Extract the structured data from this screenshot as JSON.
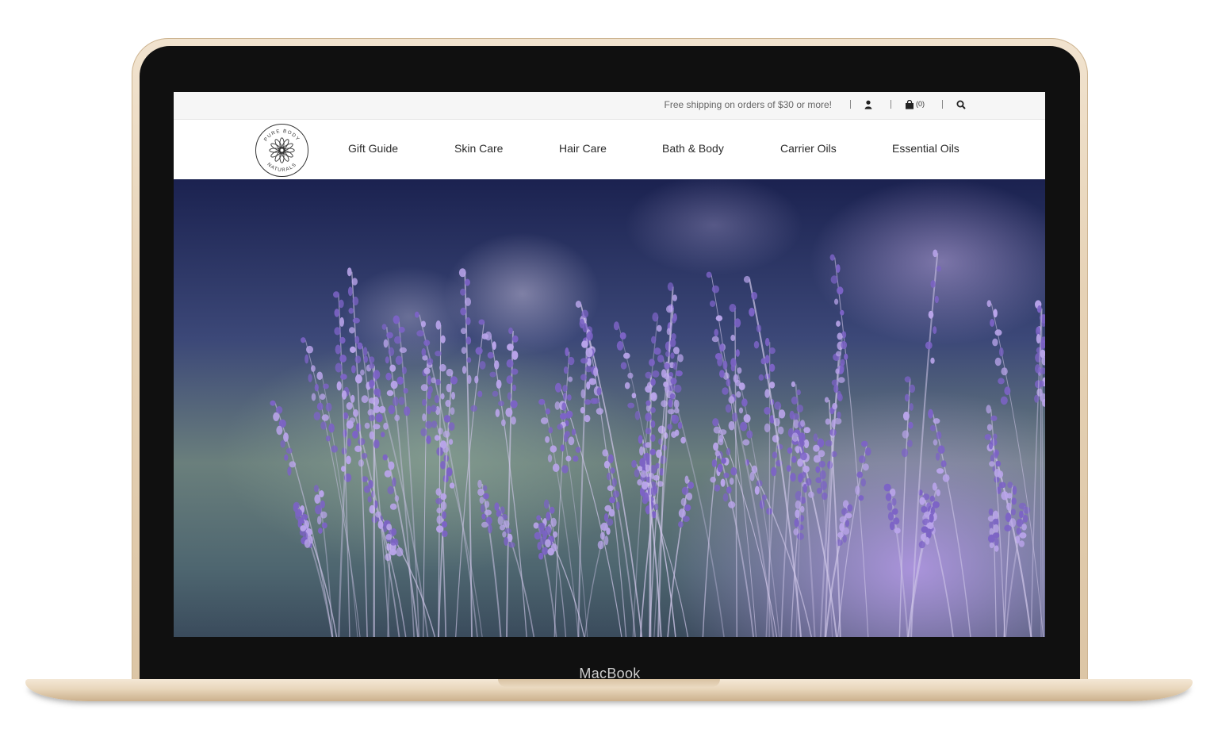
{
  "device": {
    "label": "MacBook"
  },
  "site": {
    "promo_text": "Free shipping on orders of $30 or more!",
    "cart_count": "(0)",
    "logo": {
      "top_text": "PURE BODY",
      "bottom_text": "NATURALS"
    },
    "nav": [
      {
        "label": "Gift Guide"
      },
      {
        "label": "Skin Care"
      },
      {
        "label": "Hair Care"
      },
      {
        "label": "Bath & Body"
      },
      {
        "label": "Carrier Oils"
      },
      {
        "label": "Essential Oils"
      }
    ],
    "icons": [
      "user-icon",
      "shopping-bag-icon",
      "search-icon"
    ]
  },
  "hero": {
    "subject": "lavender field photograph",
    "colors": {
      "flower": "#7c63c6",
      "flower_light": "#b9a4ea",
      "stem": "#cfc6e8"
    }
  },
  "colors": {
    "frame_gold": "#e6d2b6",
    "bezel": "#101010",
    "topbar_bg": "#f6f6f6",
    "nav_text": "#2a2a2a"
  }
}
